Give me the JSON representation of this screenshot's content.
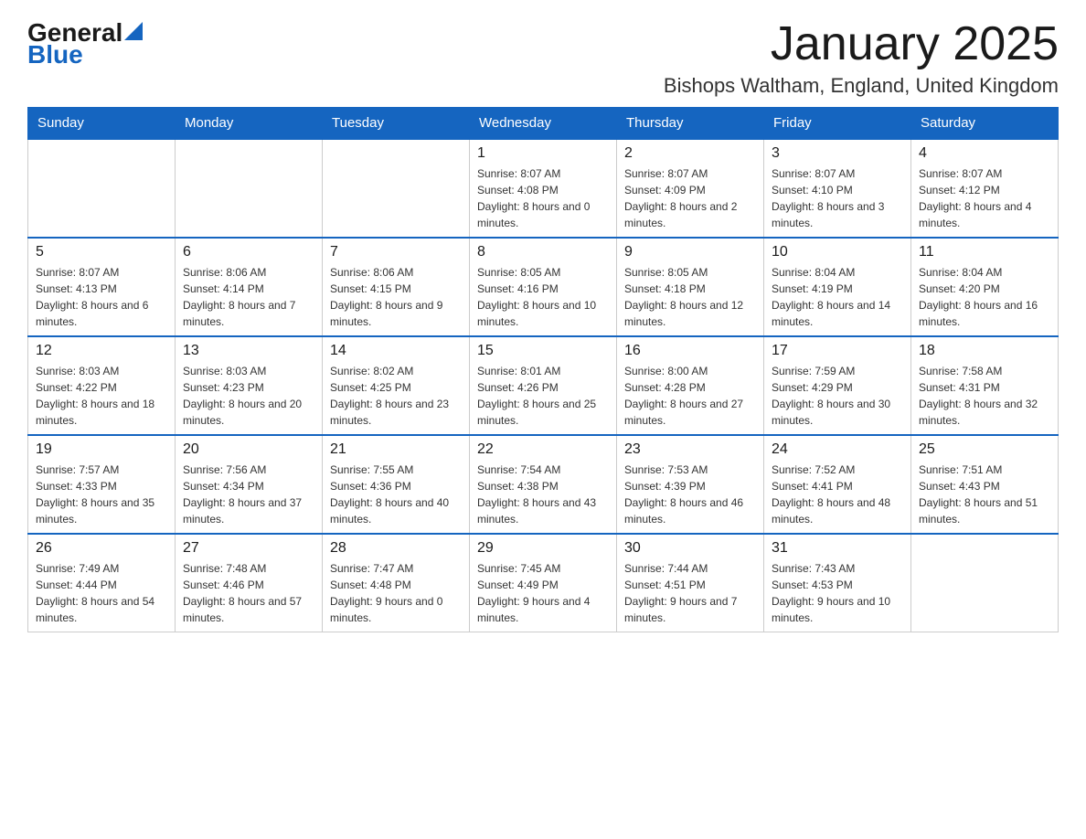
{
  "header": {
    "logo_general": "General",
    "logo_blue": "Blue",
    "title": "January 2025",
    "subtitle": "Bishops Waltham, England, United Kingdom"
  },
  "weekdays": [
    "Sunday",
    "Monday",
    "Tuesday",
    "Wednesday",
    "Thursday",
    "Friday",
    "Saturday"
  ],
  "weeks": [
    [
      {
        "day": "",
        "sunrise": "",
        "sunset": "",
        "daylight": ""
      },
      {
        "day": "",
        "sunrise": "",
        "sunset": "",
        "daylight": ""
      },
      {
        "day": "",
        "sunrise": "",
        "sunset": "",
        "daylight": ""
      },
      {
        "day": "1",
        "sunrise": "Sunrise: 8:07 AM",
        "sunset": "Sunset: 4:08 PM",
        "daylight": "Daylight: 8 hours and 0 minutes."
      },
      {
        "day": "2",
        "sunrise": "Sunrise: 8:07 AM",
        "sunset": "Sunset: 4:09 PM",
        "daylight": "Daylight: 8 hours and 2 minutes."
      },
      {
        "day": "3",
        "sunrise": "Sunrise: 8:07 AM",
        "sunset": "Sunset: 4:10 PM",
        "daylight": "Daylight: 8 hours and 3 minutes."
      },
      {
        "day": "4",
        "sunrise": "Sunrise: 8:07 AM",
        "sunset": "Sunset: 4:12 PM",
        "daylight": "Daylight: 8 hours and 4 minutes."
      }
    ],
    [
      {
        "day": "5",
        "sunrise": "Sunrise: 8:07 AM",
        "sunset": "Sunset: 4:13 PM",
        "daylight": "Daylight: 8 hours and 6 minutes."
      },
      {
        "day": "6",
        "sunrise": "Sunrise: 8:06 AM",
        "sunset": "Sunset: 4:14 PM",
        "daylight": "Daylight: 8 hours and 7 minutes."
      },
      {
        "day": "7",
        "sunrise": "Sunrise: 8:06 AM",
        "sunset": "Sunset: 4:15 PM",
        "daylight": "Daylight: 8 hours and 9 minutes."
      },
      {
        "day": "8",
        "sunrise": "Sunrise: 8:05 AM",
        "sunset": "Sunset: 4:16 PM",
        "daylight": "Daylight: 8 hours and 10 minutes."
      },
      {
        "day": "9",
        "sunrise": "Sunrise: 8:05 AM",
        "sunset": "Sunset: 4:18 PM",
        "daylight": "Daylight: 8 hours and 12 minutes."
      },
      {
        "day": "10",
        "sunrise": "Sunrise: 8:04 AM",
        "sunset": "Sunset: 4:19 PM",
        "daylight": "Daylight: 8 hours and 14 minutes."
      },
      {
        "day": "11",
        "sunrise": "Sunrise: 8:04 AM",
        "sunset": "Sunset: 4:20 PM",
        "daylight": "Daylight: 8 hours and 16 minutes."
      }
    ],
    [
      {
        "day": "12",
        "sunrise": "Sunrise: 8:03 AM",
        "sunset": "Sunset: 4:22 PM",
        "daylight": "Daylight: 8 hours and 18 minutes."
      },
      {
        "day": "13",
        "sunrise": "Sunrise: 8:03 AM",
        "sunset": "Sunset: 4:23 PM",
        "daylight": "Daylight: 8 hours and 20 minutes."
      },
      {
        "day": "14",
        "sunrise": "Sunrise: 8:02 AM",
        "sunset": "Sunset: 4:25 PM",
        "daylight": "Daylight: 8 hours and 23 minutes."
      },
      {
        "day": "15",
        "sunrise": "Sunrise: 8:01 AM",
        "sunset": "Sunset: 4:26 PM",
        "daylight": "Daylight: 8 hours and 25 minutes."
      },
      {
        "day": "16",
        "sunrise": "Sunrise: 8:00 AM",
        "sunset": "Sunset: 4:28 PM",
        "daylight": "Daylight: 8 hours and 27 minutes."
      },
      {
        "day": "17",
        "sunrise": "Sunrise: 7:59 AM",
        "sunset": "Sunset: 4:29 PM",
        "daylight": "Daylight: 8 hours and 30 minutes."
      },
      {
        "day": "18",
        "sunrise": "Sunrise: 7:58 AM",
        "sunset": "Sunset: 4:31 PM",
        "daylight": "Daylight: 8 hours and 32 minutes."
      }
    ],
    [
      {
        "day": "19",
        "sunrise": "Sunrise: 7:57 AM",
        "sunset": "Sunset: 4:33 PM",
        "daylight": "Daylight: 8 hours and 35 minutes."
      },
      {
        "day": "20",
        "sunrise": "Sunrise: 7:56 AM",
        "sunset": "Sunset: 4:34 PM",
        "daylight": "Daylight: 8 hours and 37 minutes."
      },
      {
        "day": "21",
        "sunrise": "Sunrise: 7:55 AM",
        "sunset": "Sunset: 4:36 PM",
        "daylight": "Daylight: 8 hours and 40 minutes."
      },
      {
        "day": "22",
        "sunrise": "Sunrise: 7:54 AM",
        "sunset": "Sunset: 4:38 PM",
        "daylight": "Daylight: 8 hours and 43 minutes."
      },
      {
        "day": "23",
        "sunrise": "Sunrise: 7:53 AM",
        "sunset": "Sunset: 4:39 PM",
        "daylight": "Daylight: 8 hours and 46 minutes."
      },
      {
        "day": "24",
        "sunrise": "Sunrise: 7:52 AM",
        "sunset": "Sunset: 4:41 PM",
        "daylight": "Daylight: 8 hours and 48 minutes."
      },
      {
        "day": "25",
        "sunrise": "Sunrise: 7:51 AM",
        "sunset": "Sunset: 4:43 PM",
        "daylight": "Daylight: 8 hours and 51 minutes."
      }
    ],
    [
      {
        "day": "26",
        "sunrise": "Sunrise: 7:49 AM",
        "sunset": "Sunset: 4:44 PM",
        "daylight": "Daylight: 8 hours and 54 minutes."
      },
      {
        "day": "27",
        "sunrise": "Sunrise: 7:48 AM",
        "sunset": "Sunset: 4:46 PM",
        "daylight": "Daylight: 8 hours and 57 minutes."
      },
      {
        "day": "28",
        "sunrise": "Sunrise: 7:47 AM",
        "sunset": "Sunset: 4:48 PM",
        "daylight": "Daylight: 9 hours and 0 minutes."
      },
      {
        "day": "29",
        "sunrise": "Sunrise: 7:45 AM",
        "sunset": "Sunset: 4:49 PM",
        "daylight": "Daylight: 9 hours and 4 minutes."
      },
      {
        "day": "30",
        "sunrise": "Sunrise: 7:44 AM",
        "sunset": "Sunset: 4:51 PM",
        "daylight": "Daylight: 9 hours and 7 minutes."
      },
      {
        "day": "31",
        "sunrise": "Sunrise: 7:43 AM",
        "sunset": "Sunset: 4:53 PM",
        "daylight": "Daylight: 9 hours and 10 minutes."
      },
      {
        "day": "",
        "sunrise": "",
        "sunset": "",
        "daylight": ""
      }
    ]
  ]
}
